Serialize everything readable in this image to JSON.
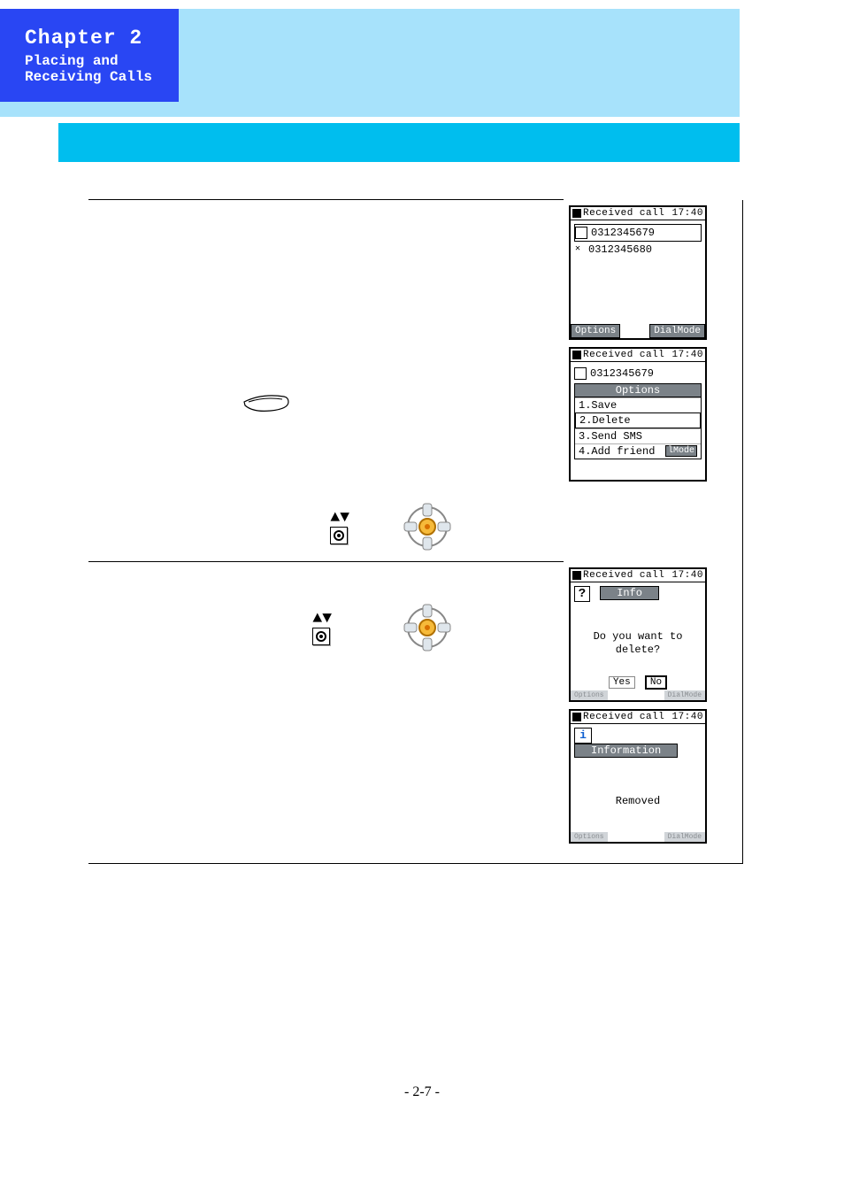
{
  "chapter": {
    "title": "Chapter 2",
    "subtitle": "Placing and\nReceiving Calls"
  },
  "screens": {
    "s1": {
      "title": "Received call",
      "time": "17:40",
      "items": [
        {
          "num": "0312345679"
        },
        {
          "num": "0312345680"
        }
      ],
      "left_softkey": "Options",
      "right_softkey": "DialMode"
    },
    "s2": {
      "title": "Received call",
      "time": "17:40",
      "item": "0312345679",
      "menu_title": "Options",
      "menu": [
        "1.Save",
        "2.Delete",
        "3.Send SMS",
        "4.Add friend"
      ],
      "right_softkey": "lMode"
    },
    "s3": {
      "title": "Received call",
      "time": "17:40",
      "badge": "Info",
      "message": "Do you want to\ndelete?",
      "yes": "Yes",
      "no": "No",
      "left_softkey": "Options",
      "right_softkey": "DialMode"
    },
    "s4": {
      "title": "Received call",
      "time": "17:40",
      "badge": "Information",
      "message": "Removed",
      "left_softkey": "Options",
      "right_softkey": "DialMode"
    }
  },
  "page_number": "- 2-7 -"
}
